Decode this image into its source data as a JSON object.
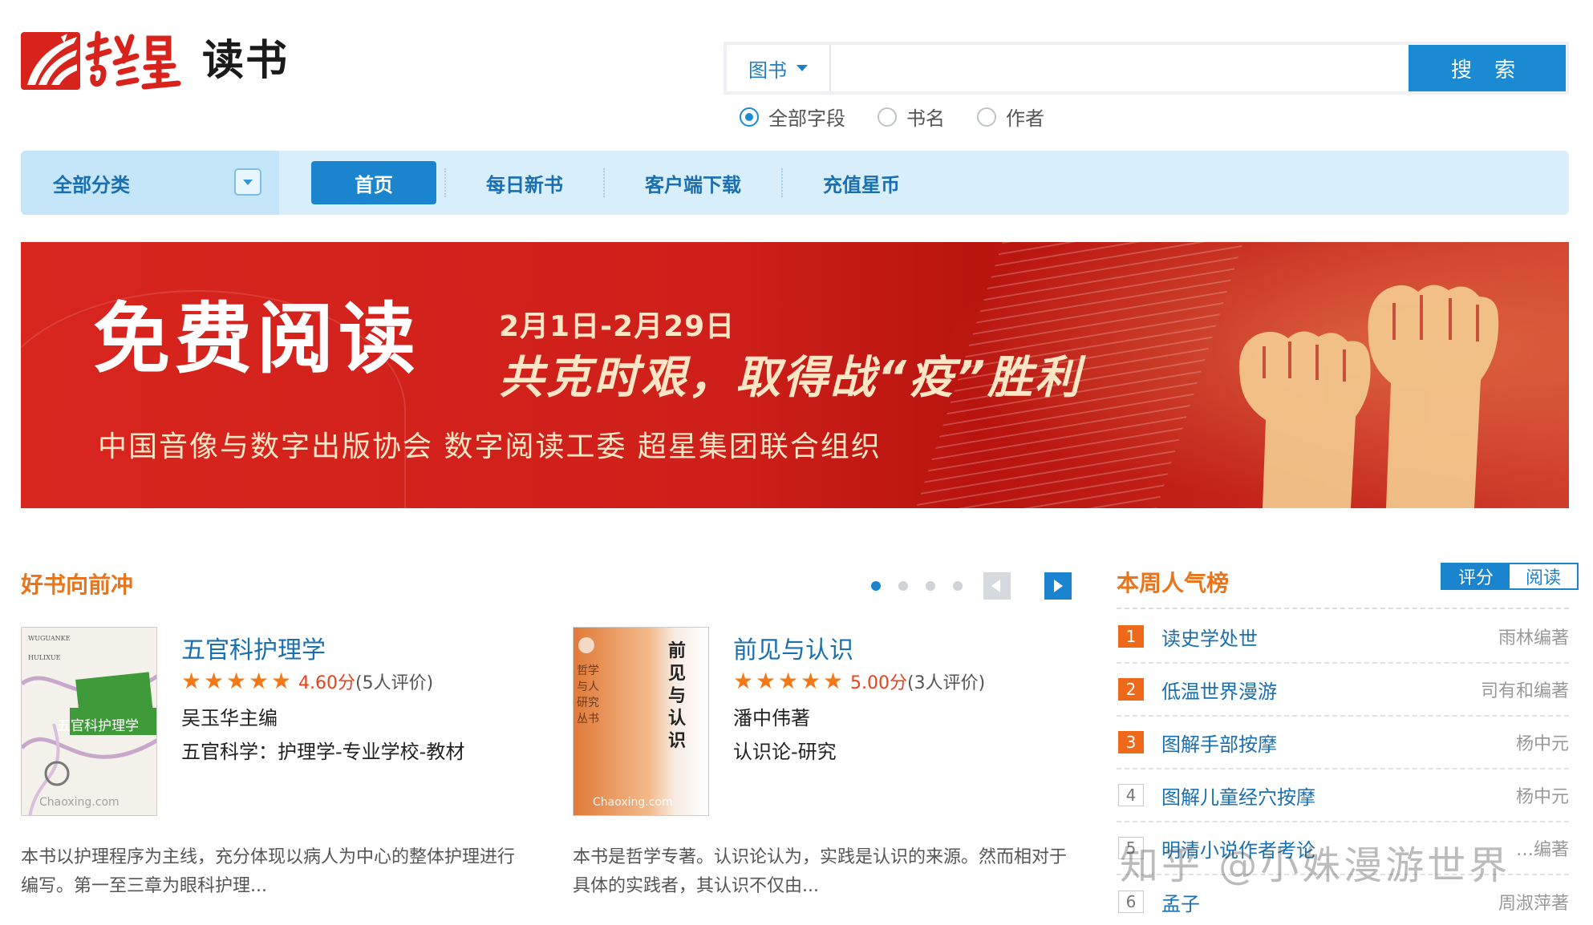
{
  "logo": {
    "brand_script": "超星",
    "product": "读书"
  },
  "search": {
    "type_selected": "图书",
    "placeholder": "",
    "button_label": "搜 索",
    "fields": [
      {
        "label": "全部字段",
        "checked": true
      },
      {
        "label": "书名",
        "checked": false
      },
      {
        "label": "作者",
        "checked": false
      }
    ]
  },
  "nav": {
    "category_label": "全部分类",
    "items": [
      {
        "label": "首页",
        "active": true
      },
      {
        "label": "每日新书",
        "active": false
      },
      {
        "label": "客户端下载",
        "active": false
      },
      {
        "label": "充值星币",
        "active": false
      }
    ]
  },
  "banner": {
    "title": "免费阅读",
    "date_range": "2月1日-2月29日",
    "slogan": "共克时艰，取得战“疫”胜利",
    "organizers": "中国音像与数字出版协会  数字阅读工委  超星集团联合组织"
  },
  "featured": {
    "title": "好书向前冲",
    "carousel": {
      "pages": 4,
      "current": 1
    },
    "books": [
      {
        "title": "五官科护理学",
        "score": "4.60分",
        "ratings": "(5人评价)",
        "stars": 5,
        "author": "吴玉华主编",
        "subject": "五官科学：护理学-专业学校-教材",
        "description": "本书以护理程序为主线，充分体现以病人为中心的整体护理进行编写。第一至三章为眼科护理...",
        "cover": {
          "title": "五官科护理学",
          "watermark": "Chaoxing.com",
          "top_text": "WUGUANKE HULIXUE",
          "bg": "#f4f1ea",
          "accent": "#3f9a3a"
        }
      },
      {
        "title": "前见与认识",
        "score": "5.00分",
        "ratings": "(3人评价)",
        "stars": 5,
        "author": "潘中伟著",
        "subject": "认识论-研究",
        "description": "本书是哲学专著。认识论认为，实践是认识的来源。然而相对于具体的实践者，其认识不仅由...",
        "cover": {
          "title": "前见与认识",
          "series": "哲学与人研究丛书",
          "watermark": "Chaoxing.com",
          "bg": "#e88a4a",
          "accent": "#f7efe6"
        }
      }
    ]
  },
  "ranking": {
    "title": "本周人气榜",
    "tabs": [
      {
        "label": "评分",
        "active": true
      },
      {
        "label": "阅读",
        "active": false
      }
    ],
    "items": [
      {
        "rank": "1",
        "title": "读史学处世",
        "author": "雨林编著"
      },
      {
        "rank": "2",
        "title": "低温世界漫游",
        "author": "司有和编著"
      },
      {
        "rank": "3",
        "title": "图解手部按摩",
        "author": "杨中元"
      },
      {
        "rank": "4",
        "title": "图解儿童经穴按摩",
        "author": "杨中元"
      },
      {
        "rank": "5",
        "title": "明清小说作者考论",
        "author": "…编著"
      },
      {
        "rank": "6",
        "title": "孟子",
        "author": "周淑萍著"
      }
    ]
  },
  "watermark": "知乎 @小姝漫游世界",
  "colors": {
    "accent": "#1a84cf",
    "orange": "#e8741c",
    "banner_red": "#d8251e",
    "nav_bg": "#d8eefb"
  }
}
